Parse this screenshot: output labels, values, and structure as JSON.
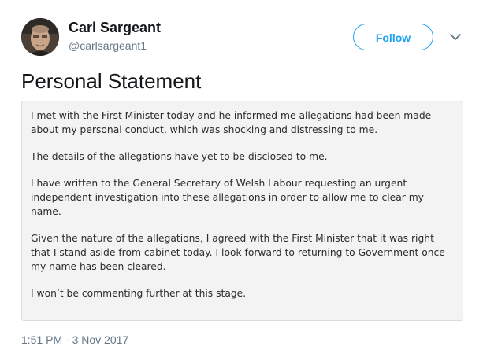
{
  "header": {
    "display_name": "Carl Sargeant",
    "handle": "@carlsargeant1",
    "follow_label": "Follow",
    "more_icon": "chevron-down-icon",
    "avatar": "profile-photo"
  },
  "tweet": {
    "text": "Personal Statement",
    "timestamp": "1:51 PM - 3 Nov 2017"
  },
  "statement_image": {
    "paragraphs": [
      "I met with the First Minister today and he informed me allegations had been made about my personal conduct, which was shocking and distressing to me.",
      "The details of the allegations have yet to be disclosed to me.",
      "I have written to the General Secretary of Welsh Labour requesting an urgent independent investigation into these allegations in order to allow me to clear my name.",
      "Given the nature of the allegations, I agreed with the First Minister that it was right that I stand aside from cabinet today. I look forward to returning to Government once my name has been cleared.",
      "I won’t be commenting further at this stage."
    ]
  },
  "colors": {
    "accent": "#1da1f2",
    "secondary_text": "#657786",
    "primary_text": "#14171a",
    "image_background": "#f3f3f3"
  }
}
